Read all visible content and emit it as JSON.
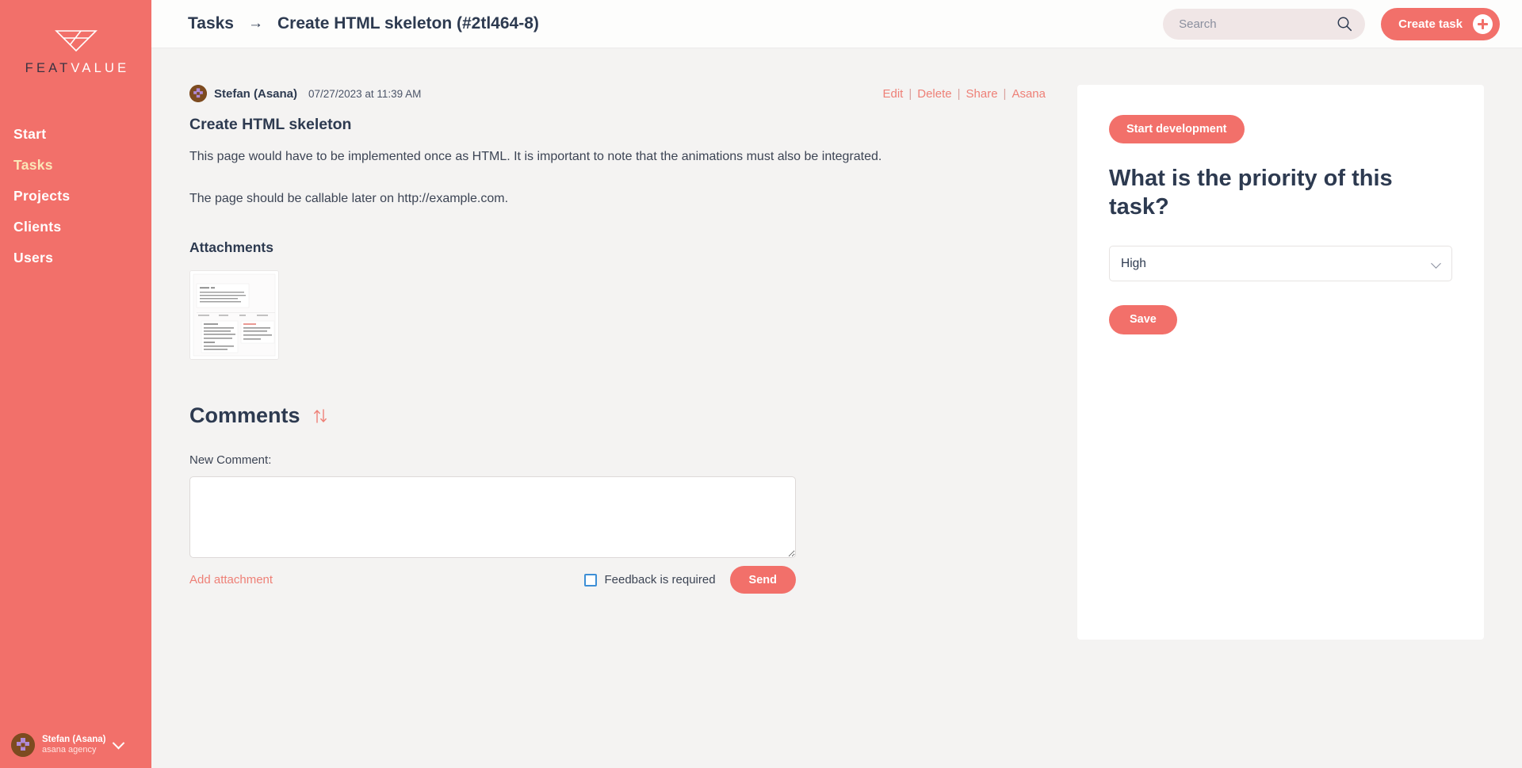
{
  "brand": {
    "name_light": "FEAT",
    "name_dark": "VALUE",
    "accent_color": "#f2706a",
    "logo_icon": "funnel-logo-icon"
  },
  "sidebar": {
    "items": [
      {
        "label": "Start",
        "active": false
      },
      {
        "label": "Tasks",
        "active": true
      },
      {
        "label": "Projects",
        "active": false
      },
      {
        "label": "Clients",
        "active": false
      },
      {
        "label": "Users",
        "active": false
      }
    ],
    "user": {
      "name": "Stefan (Asana)",
      "org": "asana agency",
      "caret_icon": "chevron-down-icon",
      "avatar_icon": "user-avatar"
    }
  },
  "header": {
    "breadcrumb": {
      "parent": "Tasks",
      "arrow": "→",
      "current": "Create HTML skeleton (#2tl464-8)"
    },
    "search": {
      "placeholder": "Search",
      "value": "",
      "icon": "search-icon"
    },
    "create_task": {
      "label": "Create task",
      "icon": "plus-circle-icon"
    }
  },
  "task": {
    "author": "Stefan (Asana)",
    "date": "07/27/2023 at 11:39 AM",
    "actions": [
      {
        "label": "Edit"
      },
      {
        "label": "Delete"
      },
      {
        "label": "Share"
      },
      {
        "label": "Asana"
      }
    ],
    "action_separator": "|",
    "title": "Create HTML skeleton",
    "paragraph_1": "This page would have to be implemented once as HTML. It is important to note that the animations must also be integrated.",
    "paragraph_2": "The page should be callable later on http://example.com.",
    "attachments_heading": "Attachments",
    "attachment_name": "document-thumbnail"
  },
  "comments": {
    "heading": "Comments",
    "sort_icon": "sort-arrows-icon",
    "new_comment_label": "New Comment:",
    "textarea_value": "",
    "textarea_placeholder": "",
    "add_attachment_label": "Add attachment",
    "feedback_checkbox_label": "Feedback is required",
    "feedback_checked": false,
    "send_label": "Send"
  },
  "panel": {
    "status_button": "Start development",
    "question": "What is the priority of this task?",
    "priority_value": "High",
    "priority_options": [
      "High"
    ],
    "caret_icon": "chevron-down-icon",
    "save_label": "Save"
  }
}
